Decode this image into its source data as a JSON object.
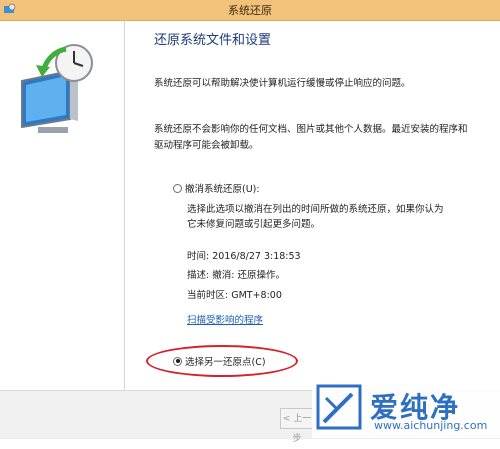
{
  "window": {
    "title": "系统还原"
  },
  "page": {
    "heading": "还原系统文件和设置",
    "intro": "系统还原可以帮助解决使计算机运行缓慢或停止响应的问题。",
    "note": "系统还原不会影响你的任何文档、图片或其他个人数据。最近安装的程序和驱动程序可能会被卸载。"
  },
  "options": {
    "undo": {
      "label": "撤消系统还原(U):",
      "checked": false,
      "description": "选择此选项以撤消在列出的时间所做的系统还原，如果你认为它未修复问题或引起更多问题。",
      "time": "时间: 2016/8/27 3:18:53",
      "desc_line": "描述: 撤消: 还原操作。",
      "timezone": "当前时区: GMT+8:00",
      "scan_link": "扫描受影响的程序"
    },
    "choose": {
      "label": "选择另一还原点(C)",
      "checked": true
    }
  },
  "footer": {
    "prev_label": "< 上一步"
  },
  "watermark": {
    "brand": "爱纯净",
    "url": "www.aichunjing.com"
  },
  "colors": {
    "titlebar": "#f3c27a",
    "heading": "#1e3a7a",
    "link": "#1a5fb4",
    "highlight": "#d4232a"
  }
}
